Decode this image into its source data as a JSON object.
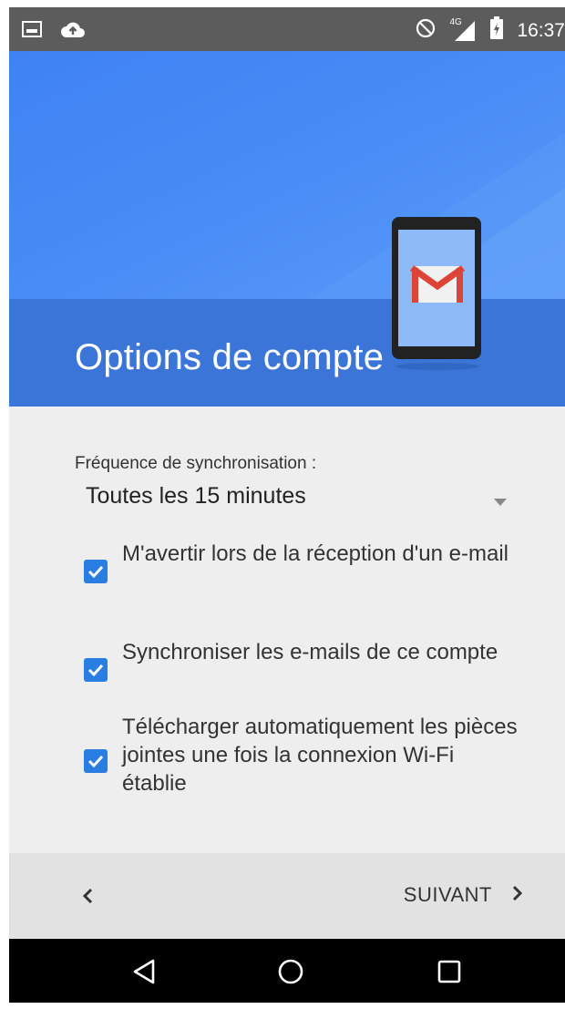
{
  "status_bar": {
    "time": "16:37",
    "network": "4G",
    "left_icons": [
      "image-icon",
      "cloud-upload-icon"
    ],
    "right_icons": [
      "do-not-disturb-icon",
      "signal-icon",
      "battery-icon"
    ]
  },
  "header": {
    "title": "Options de compte",
    "illustration": "phone-gmail-icon",
    "colors": {
      "primary": "#4285f4",
      "dark": "#3b75d8",
      "gmail_red": "#db4437"
    }
  },
  "sync": {
    "label": "Fréquence de synchronisation :",
    "value": "Toutes les 15 minutes"
  },
  "options": [
    {
      "label": "M'avertir lors de la réception d'un e-mail",
      "checked": true
    },
    {
      "label": "Synchroniser les e-mails de ce compte",
      "checked": true
    },
    {
      "label": "Télécharger automatiquement les pièces jointes une fois la connexion Wi-Fi établie",
      "checked": true
    }
  ],
  "footer": {
    "back_icon": "chevron-left-icon",
    "next_label": "SUIVANT",
    "next_icon": "chevron-right-icon"
  },
  "nav_bar": [
    "back-triangle-icon",
    "home-circle-icon",
    "recents-square-icon"
  ]
}
